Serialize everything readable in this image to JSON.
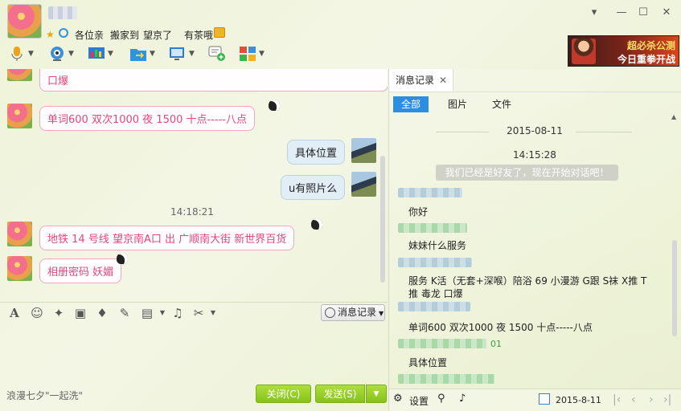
{
  "header": {
    "signature_parts": [
      "各位亲",
      "搬家到",
      "望京了",
      "有茶哦"
    ],
    "window_buttons": [
      "▾",
      "—",
      "☐",
      "✕"
    ]
  },
  "ad": {
    "line1": "超必杀公测",
    "line2": "今日重拳开战"
  },
  "toolbar": {
    "items": [
      "microphone-icon",
      "camera-icon",
      "screen-share-icon",
      "file-transfer-icon",
      "remote-desktop-icon",
      "add-message-icon",
      "apps-icon"
    ]
  },
  "chat": {
    "messages": [
      {
        "side": "in",
        "text": "口爆"
      },
      {
        "side": "in",
        "text": "单词600   双次1000   夜  1500   十点-----八点"
      },
      {
        "side": "out",
        "text": "具体位置"
      },
      {
        "side": "out",
        "text": "u有照片么"
      },
      {
        "side": "in",
        "text": "地铁 14 号线    望京南A口   出     广顺南大街 新世界百货"
      },
      {
        "side": "in",
        "text": "相册密码  妖媚"
      }
    ],
    "timestamp": "14:18:21"
  },
  "format_bar": {
    "history_label": "消息记录"
  },
  "input": {
    "hint": "浪漫七夕\"一起洗\"",
    "close_label": "关闭(C)",
    "send_label": "发送(S)"
  },
  "history": {
    "tab_label": "消息记录",
    "filters": [
      "全部",
      "图片",
      "文件"
    ],
    "date": "2015-08-11",
    "time": "14:15:28",
    "system_msg": "我们已经是好友了，现在开始对话吧！",
    "entries": [
      {
        "text": "你好"
      },
      {
        "text": "妹妹什么服务"
      },
      {
        "text": "服务 K活（无套+深喉）陪浴 69 小漫游  G跟 S袜 X推 T推 毒龙  口爆"
      },
      {
        "text": "单词600   双次1000   夜  1500   十点-----八点"
      },
      {
        "text": "具体位置"
      }
    ],
    "tail_time": "01",
    "footer": {
      "settings_label": "设置",
      "date": "2015-8-11"
    }
  },
  "colors": {
    "accent": "#2b8ee0",
    "bubble_in_text": "#e4467f",
    "bubble_in_border": "#f0a6c4",
    "button_green": "#88c21c"
  }
}
